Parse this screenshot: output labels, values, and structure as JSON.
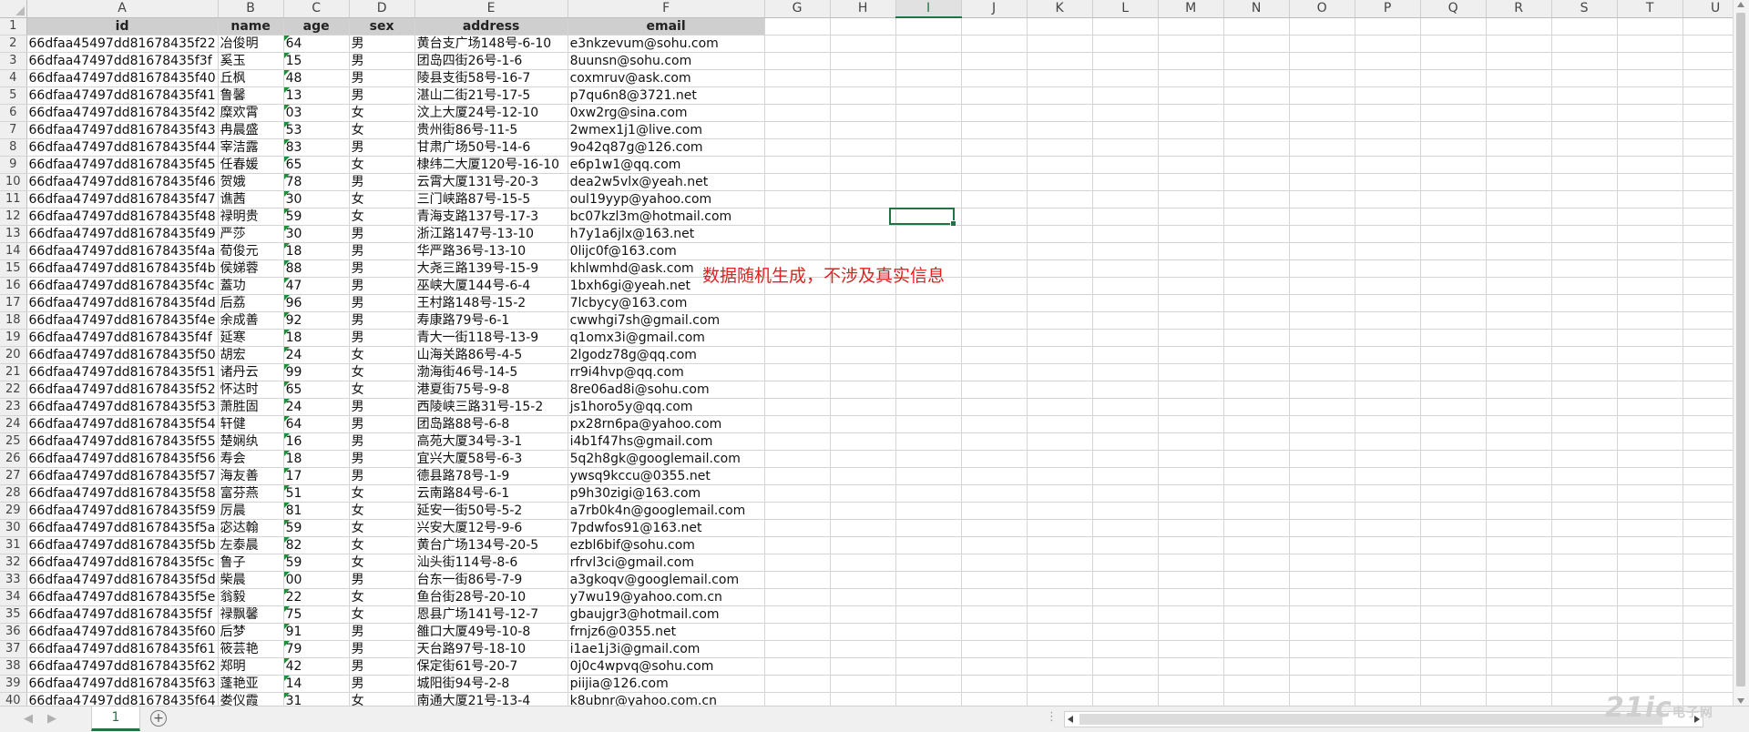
{
  "columns": [
    "A",
    "B",
    "C",
    "D",
    "E",
    "F",
    "G",
    "H",
    "I",
    "J",
    "K",
    "L",
    "M",
    "N",
    "O",
    "P",
    "Q",
    "R",
    "S",
    "T",
    "U"
  ],
  "selected_column": "I",
  "headers": [
    "id",
    "name",
    "age",
    "sex",
    "address",
    "email"
  ],
  "rows": [
    [
      "66dfaa45497dd81678435f22",
      "冶俊明",
      "64",
      "男",
      "黄台支广场148号-6-10",
      "e3nkzevum@sohu.com"
    ],
    [
      "66dfaa47497dd81678435f3f",
      "奚玉",
      "15",
      "男",
      "团岛四街26号-1-6",
      "8uunsn@sohu.com"
    ],
    [
      "66dfaa47497dd81678435f40",
      "丘枫",
      "48",
      "男",
      "陵县支街58号-16-7",
      "coxmruv@ask.com"
    ],
    [
      "66dfaa47497dd81678435f41",
      "鲁馨",
      "13",
      "男",
      "湛山二街21号-17-5",
      "p7qu6n8@3721.net"
    ],
    [
      "66dfaa47497dd81678435f42",
      "糜欢霄",
      "03",
      "女",
      "汶上大厦24号-12-10",
      "0xw2rg@sina.com"
    ],
    [
      "66dfaa47497dd81678435f43",
      "冉晨盛",
      "53",
      "女",
      "贵州街86号-11-5",
      "2wmex1j1@live.com"
    ],
    [
      "66dfaa47497dd81678435f44",
      "宰洁露",
      "83",
      "男",
      "甘肃广场50号-14-6",
      "9o42q87g@126.com"
    ],
    [
      "66dfaa47497dd81678435f45",
      "任春媛",
      "65",
      "女",
      "棣纬二大厦120号-16-10",
      "e6p1w1@qq.com"
    ],
    [
      "66dfaa47497dd81678435f46",
      "贺娥",
      "78",
      "男",
      "云霄大厦131号-20-3",
      "dea2w5vlx@yeah.net"
    ],
    [
      "66dfaa47497dd81678435f47",
      "谯茜",
      "30",
      "女",
      "三门峡路87号-15-5",
      "oul19yyp@yahoo.com"
    ],
    [
      "66dfaa47497dd81678435f48",
      "禄明贵",
      "59",
      "女",
      "青海支路137号-17-3",
      "bc07kzl3m@hotmail.com"
    ],
    [
      "66dfaa47497dd81678435f49",
      "严莎",
      "30",
      "男",
      "浙江路147号-13-10",
      "h7y1a6jlx@163.net"
    ],
    [
      "66dfaa47497dd81678435f4a",
      "荀俊元",
      "18",
      "男",
      "华严路36号-13-10",
      "0lijc0f@163.com"
    ],
    [
      "66dfaa47497dd81678435f4b",
      "侯娣蓉",
      "88",
      "男",
      "大尧三路139号-15-9",
      "khlwmhd@ask.com"
    ],
    [
      "66dfaa47497dd81678435f4c",
      "蓋功",
      "47",
      "男",
      "巫峡大厦144号-6-4",
      "1bxh6gi@yeah.net"
    ],
    [
      "66dfaa47497dd81678435f4d",
      "后荔",
      "96",
      "男",
      "王村路148号-15-2",
      "7lcbycy@163.com"
    ],
    [
      "66dfaa47497dd81678435f4e",
      "余成善",
      "92",
      "男",
      "寿康路79号-6-1",
      "cwwhgi7sh@gmail.com"
    ],
    [
      "66dfaa47497dd81678435f4f",
      "延寒",
      "18",
      "男",
      "青大一街118号-13-9",
      "q1omx3i@gmail.com"
    ],
    [
      "66dfaa47497dd81678435f50",
      "胡宏",
      "24",
      "女",
      "山海关路86号-4-5",
      "2lgodz78g@qq.com"
    ],
    [
      "66dfaa47497dd81678435f51",
      "诸丹云",
      "99",
      "女",
      "渤海街46号-14-5",
      "rr9i4hvp@qq.com"
    ],
    [
      "66dfaa47497dd81678435f52",
      "怀达时",
      "65",
      "女",
      "港夏街75号-9-8",
      "8re06ad8i@sohu.com"
    ],
    [
      "66dfaa47497dd81678435f53",
      "萧胜固",
      "24",
      "男",
      "西陵峡三路31号-15-2",
      "js1horo5y@qq.com"
    ],
    [
      "66dfaa47497dd81678435f54",
      "轩健",
      "64",
      "男",
      "团岛路88号-6-8",
      "px28rn6pa@yahoo.com"
    ],
    [
      "66dfaa47497dd81678435f55",
      "楚娴纨",
      "16",
      "男",
      "高苑大厦34号-3-1",
      "i4b1f47hs@gmail.com"
    ],
    [
      "66dfaa47497dd81678435f56",
      "寿会",
      "18",
      "男",
      "宜兴大厦58号-6-3",
      "5q2h8gk@googlemail.com"
    ],
    [
      "66dfaa47497dd81678435f57",
      "海友善",
      "17",
      "男",
      "德县路78号-1-9",
      "ywsq9kccu@0355.net"
    ],
    [
      "66dfaa47497dd81678435f58",
      "富芬燕",
      "51",
      "女",
      "云南路84号-6-1",
      "p9h30zigi@163.com"
    ],
    [
      "66dfaa47497dd81678435f59",
      "厉晨",
      "81",
      "女",
      "延安一街50号-5-2",
      "a7rb0k4n@googlemail.com"
    ],
    [
      "66dfaa47497dd81678435f5a",
      "宓达翰",
      "59",
      "女",
      "兴安大厦12号-9-6",
      "7pdwfos91@163.net"
    ],
    [
      "66dfaa47497dd81678435f5b",
      "左泰晨",
      "82",
      "女",
      "黄台广场134号-20-5",
      "ezbl6bif@sohu.com"
    ],
    [
      "66dfaa47497dd81678435f5c",
      "鲁子",
      "59",
      "女",
      "汕头街114号-8-6",
      "rfrvl3ci@gmail.com"
    ],
    [
      "66dfaa47497dd81678435f5d",
      "柴晨",
      "00",
      "男",
      "台东一街86号-7-9",
      "a3gkoqv@googlemail.com"
    ],
    [
      "66dfaa47497dd81678435f5e",
      "翁毅",
      "22",
      "女",
      "鱼台街28号-20-10",
      "y7wu19@yahoo.com.cn"
    ],
    [
      "66dfaa47497dd81678435f5f",
      "禄飘馨",
      "75",
      "女",
      "恩县广场141号-12-7",
      "gbaujgr3@hotmail.com"
    ],
    [
      "66dfaa47497dd81678435f60",
      "后梦",
      "91",
      "男",
      "雒口大厦49号-10-8",
      "frnjz6@0355.net"
    ],
    [
      "66dfaa47497dd81678435f61",
      "筱芸艳",
      "79",
      "男",
      "天台路97号-18-10",
      "i1ae1j3i@gmail.com"
    ],
    [
      "66dfaa47497dd81678435f62",
      "郑明",
      "42",
      "男",
      "保定街61号-20-7",
      "0j0c4wpvq@sohu.com"
    ],
    [
      "66dfaa47497dd81678435f63",
      "蓬艳亚",
      "14",
      "男",
      "城阳街94号-2-8",
      "piijia@126.com"
    ],
    [
      "66dfaa47497dd81678435f64",
      "娄仪霞",
      "31",
      "女",
      "南通大厦21号-13-4",
      "k8ubnr@yahoo.com.cn"
    ]
  ],
  "note": "数据随机生成，不涉及真实信息",
  "sheet_tab": "1",
  "accent": "#217346",
  "watermark": "21ic电子网"
}
